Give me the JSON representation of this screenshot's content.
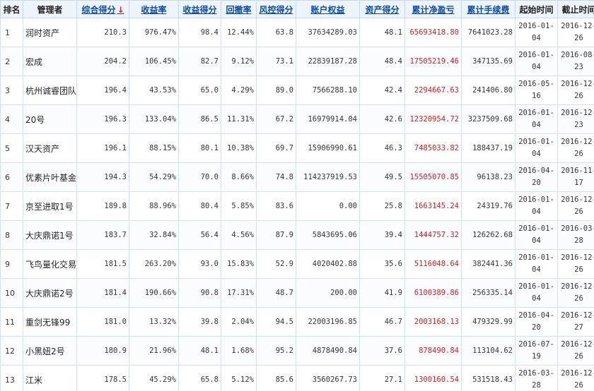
{
  "columns": {
    "rank": "排名",
    "manager": "管理者",
    "composite": "综合得分",
    "yield": "收益率",
    "yield_score": "收益得分",
    "drawdown": "回撤率",
    "risk_score": "风控得分",
    "equity": "账户权益",
    "asset_score": "资产得分",
    "net_pnl": "累计净盈亏",
    "fees": "累计手续费",
    "start_time": "起始时间",
    "end_time": "截止时间"
  },
  "sort_indicator": "↓",
  "accent_colors": {
    "header_link": "#0b4aa8",
    "profit": "#cc1f1f",
    "header_bg": "#eef4fb"
  },
  "rows": [
    {
      "rank": "1",
      "manager": "润时资产",
      "composite": "210.3",
      "yield": "976.47%",
      "yield_score": "98.4",
      "drawdown": "12.44%",
      "risk_score": "63.8",
      "equity": "37634289.03",
      "asset_score": "48.1",
      "net_pnl": "65693418.80",
      "fees": "7641023.28",
      "start_a": "2016-01-",
      "start_b": "04",
      "end_a": "2016-12-",
      "end_b": "26"
    },
    {
      "rank": "2",
      "manager": "宏成",
      "composite": "204.2",
      "yield": "106.45%",
      "yield_score": "82.7",
      "drawdown": "9.12%",
      "risk_score": "73.1",
      "equity": "22839187.28",
      "asset_score": "48.4",
      "net_pnl": "17505219.46",
      "fees": "347135.69",
      "start_a": "2016-01-",
      "start_b": "04",
      "end_a": "2016-08-",
      "end_b": "23"
    },
    {
      "rank": "3",
      "manager": "杭州诚睿团队",
      "composite": "196.4",
      "yield": "43.53%",
      "yield_score": "65.0",
      "drawdown": "4.29%",
      "risk_score": "89.0",
      "equity": "7566288.10",
      "asset_score": "42.4",
      "net_pnl": "2294667.63",
      "fees": "241406.80",
      "start_a": "2016-05-",
      "start_b": "16",
      "end_a": "2016-12-",
      "end_b": "26"
    },
    {
      "rank": "4",
      "manager": "20号",
      "composite": "196.3",
      "yield": "133.04%",
      "yield_score": "86.5",
      "drawdown": "11.31%",
      "risk_score": "67.2",
      "equity": "16979914.04",
      "asset_score": "42.6",
      "net_pnl": "12320954.72",
      "fees": "3237509.68",
      "start_a": "2016-01-",
      "start_b": "04",
      "end_a": "2016-12-",
      "end_b": "23"
    },
    {
      "rank": "5",
      "manager": "汉天资产",
      "composite": "196.1",
      "yield": "88.15%",
      "yield_score": "80.1",
      "drawdown": "10.38%",
      "risk_score": "69.7",
      "equity": "15906990.61",
      "asset_score": "46.3",
      "net_pnl": "7485033.82",
      "fees": "188437.19",
      "start_a": "2016-01-",
      "start_b": "04",
      "end_a": "2016-12-",
      "end_b": "26"
    },
    {
      "rank": "6",
      "manager": "优素片叶基金",
      "composite": "194.3",
      "yield": "54.29%",
      "yield_score": "70.0",
      "drawdown": "8.66%",
      "risk_score": "74.8",
      "equity": "114237919.53",
      "asset_score": "49.5",
      "net_pnl": "15505070.85",
      "fees": "96138.23",
      "start_a": "2016-04-",
      "start_b": "20",
      "end_a": "2016-11-",
      "end_b": "17"
    },
    {
      "rank": "7",
      "manager": "京至进取1号",
      "composite": "189.8",
      "yield": "88.96%",
      "yield_score": "80.4",
      "drawdown": "5.85%",
      "risk_score": "83.6",
      "equity": "0.00",
      "asset_score": "25.8",
      "net_pnl": "1663145.24",
      "fees": "24319.76",
      "start_a": "2016-01-",
      "start_b": "04",
      "end_a": "2016-12-",
      "end_b": "26"
    },
    {
      "rank": "8",
      "manager": "大庆鼎诺1号",
      "composite": "183.7",
      "yield": "32.84%",
      "yield_score": "56.4",
      "drawdown": "4.56%",
      "risk_score": "87.9",
      "equity": "5843695.06",
      "asset_score": "39.4",
      "net_pnl": "1444757.32",
      "fees": "126262.68",
      "start_a": "2016-01-",
      "start_b": "04",
      "end_a": "2016-03-",
      "end_b": "28"
    },
    {
      "rank": "9",
      "manager": "飞鸟量化交易",
      "composite": "181.5",
      "yield": "263.20%",
      "yield_score": "93.0",
      "drawdown": "15.83%",
      "risk_score": "52.9",
      "equity": "4020402.88",
      "asset_score": "35.6",
      "net_pnl": "5116048.64",
      "fees": "382441.36",
      "start_a": "2016-01-",
      "start_b": "04",
      "end_a": "2016-12-",
      "end_b": "26"
    },
    {
      "rank": "10",
      "manager": "大庆鼎诺2号",
      "composite": "181.4",
      "yield": "190.66%",
      "yield_score": "90.8",
      "drawdown": "17.31%",
      "risk_score": "48.7",
      "equity": "200.00",
      "asset_score": "41.9",
      "net_pnl": "6100389.86",
      "fees": "256335.14",
      "start_a": "2016-01-",
      "start_b": "04",
      "end_a": "2016-12-",
      "end_b": "26"
    },
    {
      "rank": "11",
      "manager": "重剑无锋99",
      "composite": "181.0",
      "yield": "13.32%",
      "yield_score": "39.8",
      "drawdown": "2.04%",
      "risk_score": "94.5",
      "equity": "22003196.85",
      "asset_score": "46.7",
      "net_pnl": "2003168.13",
      "fees": "479329.99",
      "start_a": "2016-04-",
      "start_b": "20",
      "end_a": "2016-12-",
      "end_b": "27"
    },
    {
      "rank": "12",
      "manager": "小黑妞2号",
      "composite": "180.9",
      "yield": "21.96%",
      "yield_score": "48.1",
      "drawdown": "1.68%",
      "risk_score": "95.2",
      "equity": "4878490.84",
      "asset_score": "37.6",
      "net_pnl": "878490.84",
      "fees": "113104.62",
      "start_a": "2016-07-",
      "start_b": "19",
      "end_a": "2016-12-",
      "end_b": "26"
    },
    {
      "rank": "13",
      "manager": "江米",
      "composite": "178.5",
      "yield": "45.29%",
      "yield_score": "65.8",
      "drawdown": "5.12%",
      "risk_score": "85.6",
      "equity": "3560267.73",
      "asset_score": "27.1",
      "net_pnl": "1300160.54",
      "fees": "531518.43",
      "start_a": "2016-03-",
      "start_b": "28",
      "end_a": "2016-12-",
      "end_b": "26"
    }
  ]
}
